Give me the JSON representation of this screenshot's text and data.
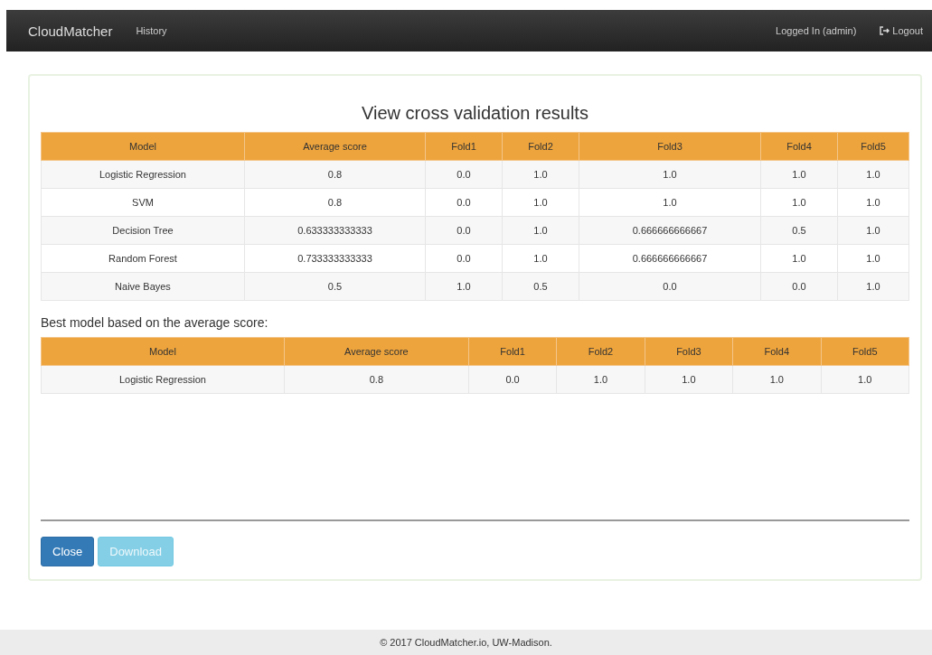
{
  "navbar": {
    "brand": "CloudMatcher",
    "links": [
      {
        "label": "History"
      }
    ],
    "user": "Logged In (admin)",
    "logout": "Logout"
  },
  "title": "View cross validation results",
  "results_table": {
    "columns": [
      "Model",
      "Average score",
      "Fold1",
      "Fold2",
      "Fold3",
      "Fold4",
      "Fold5"
    ],
    "rows": [
      [
        "Logistic Regression",
        "0.8",
        "0.0",
        "1.0",
        "1.0",
        "1.0",
        "1.0"
      ],
      [
        "SVM",
        "0.8",
        "0.0",
        "1.0",
        "1.0",
        "1.0",
        "1.0"
      ],
      [
        "Decision Tree",
        "0.633333333333",
        "0.0",
        "1.0",
        "0.666666666667",
        "0.5",
        "1.0"
      ],
      [
        "Random Forest",
        "0.733333333333",
        "0.0",
        "1.0",
        "0.666666666667",
        "1.0",
        "1.0"
      ],
      [
        "Naive Bayes",
        "0.5",
        "1.0",
        "0.5",
        "0.0",
        "0.0",
        "1.0"
      ]
    ]
  },
  "best_label": "Best model based on the average score:",
  "best_table": {
    "columns": [
      "Model",
      "Average score",
      "Fold1",
      "Fold2",
      "Fold3",
      "Fold4",
      "Fold5"
    ],
    "rows": [
      [
        "Logistic Regression",
        "0.8",
        "0.0",
        "1.0",
        "1.0",
        "1.0",
        "1.0"
      ]
    ]
  },
  "buttons": [
    {
      "label": "Close",
      "kind": "primary",
      "disabled": false
    },
    {
      "label": "Download",
      "kind": "info",
      "disabled": true
    }
  ],
  "footer": "© 2017 CloudMatcher.io, UW-Madison."
}
